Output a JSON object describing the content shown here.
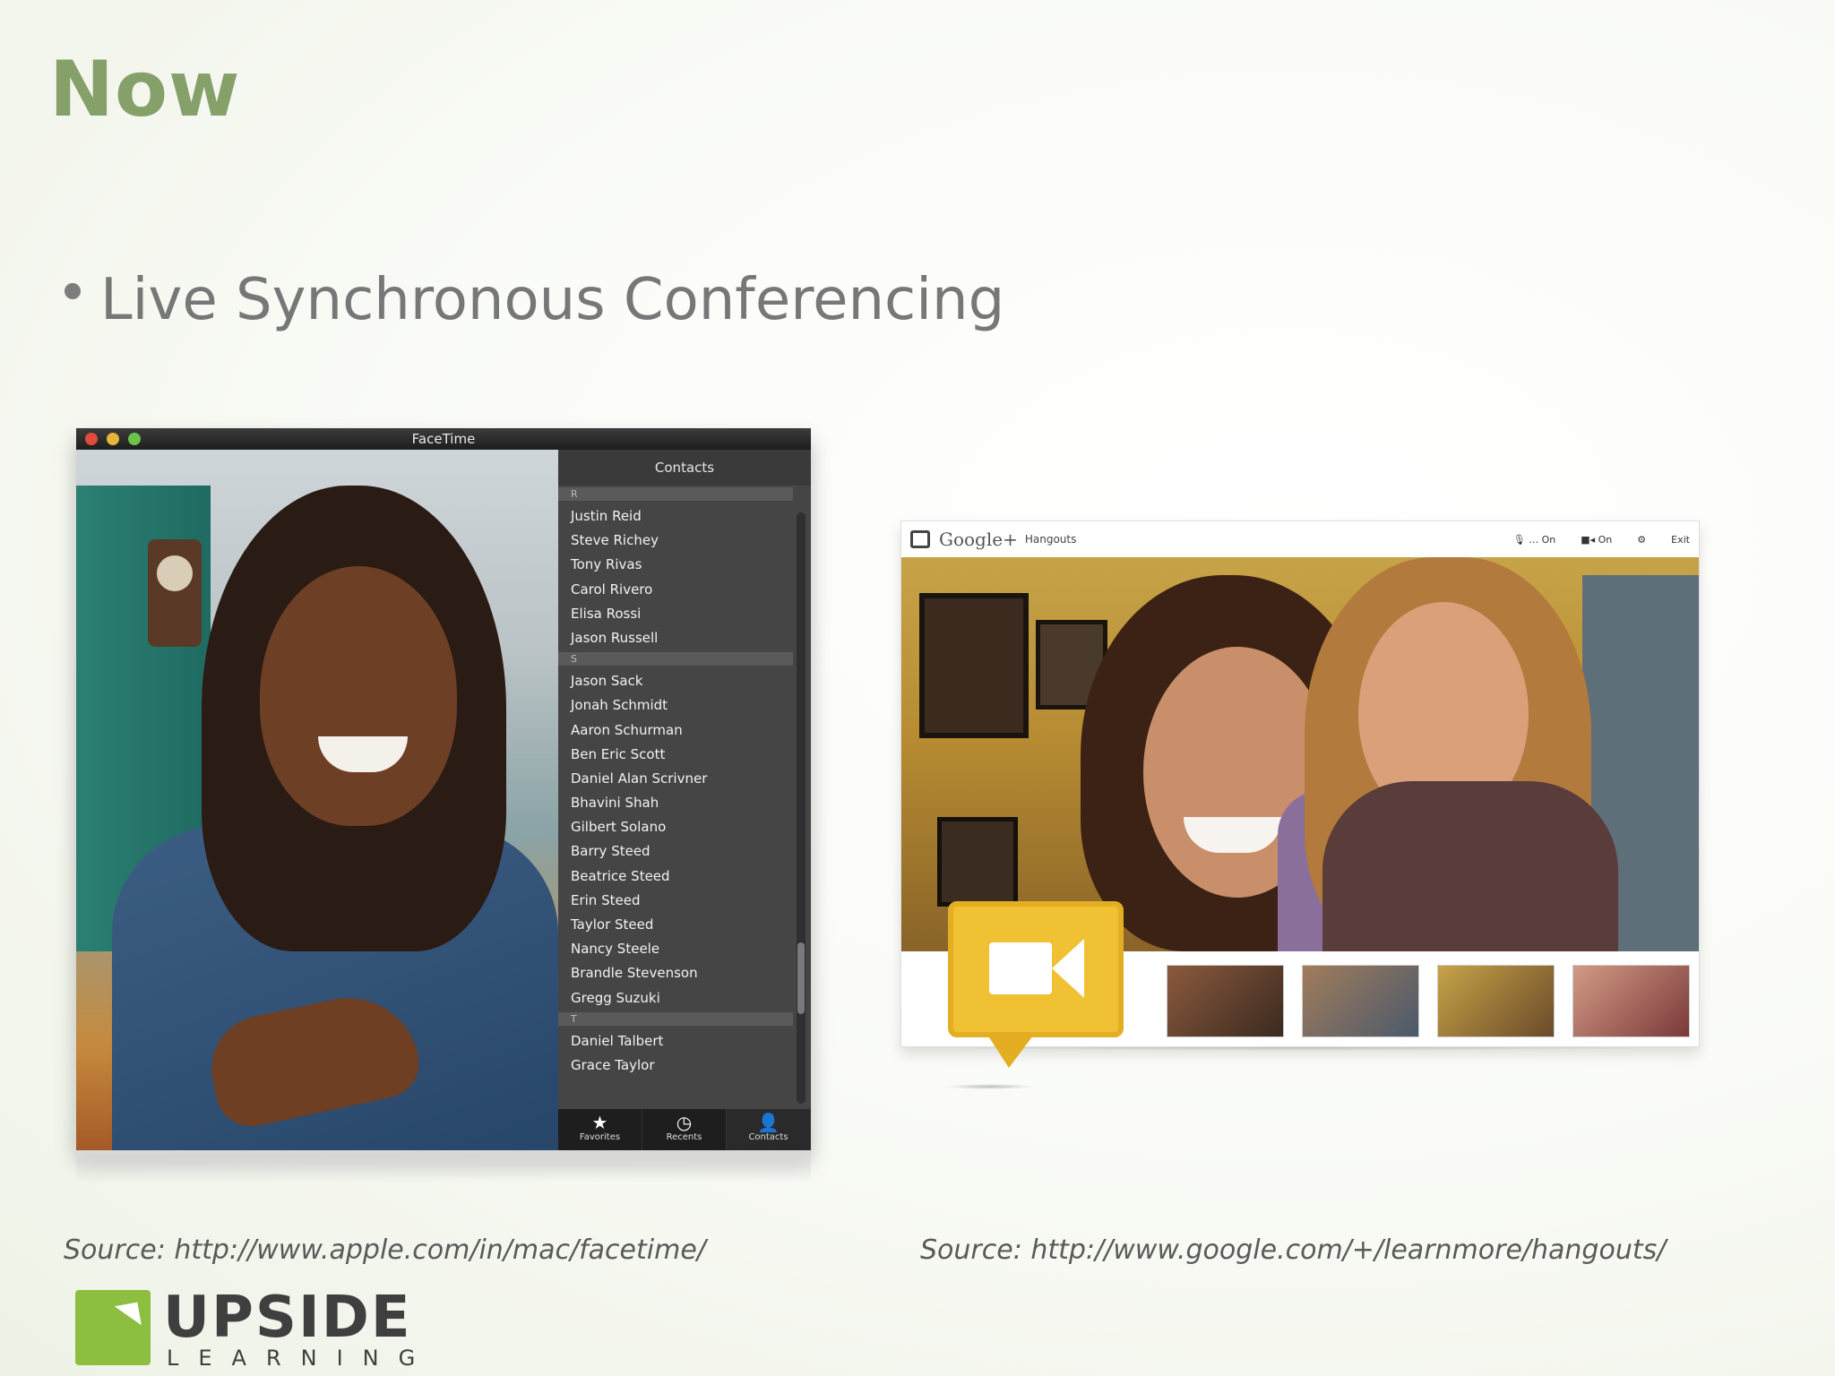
{
  "slide": {
    "title": "Now",
    "bullet": "Live Synchronous Conferencing"
  },
  "facetime": {
    "window_title": "FaceTime",
    "contacts_header": "Contacts",
    "sections": [
      {
        "letter": "R",
        "contacts": [
          "Justin Reid",
          "Steve Richey",
          "Tony Rivas",
          "Carol Rivero",
          "Elisa Rossi",
          "Jason Russell"
        ]
      },
      {
        "letter": "S",
        "contacts": [
          "Jason Sack",
          "Jonah Schmidt",
          "Aaron Schurman",
          "Ben Eric Scott",
          "Daniel Alan Scrivner",
          "Bhavini Shah",
          "Gilbert Solano",
          "Barry Steed",
          "Beatrice Steed",
          "Erin Steed",
          "Taylor Steed",
          "Nancy Steele",
          "Brandle Stevenson",
          "Gregg Suzuki"
        ]
      },
      {
        "letter": "T",
        "contacts": [
          "Daniel Talbert",
          "Grace Taylor"
        ]
      }
    ],
    "tabs": [
      {
        "label": "Favorites",
        "icon": "star-icon",
        "glyph": "★"
      },
      {
        "label": "Recents",
        "icon": "clock-icon",
        "glyph": "◷"
      },
      {
        "label": "Contacts",
        "icon": "person-icon",
        "glyph": "👤"
      }
    ],
    "active_tab": "Contacts"
  },
  "hangouts": {
    "brand": "Google+",
    "product": "Hangouts",
    "mic_label": "On",
    "camera_label": "On",
    "exit_label": "Exit"
  },
  "sources": {
    "left": "Source: http://www.apple.com/in/mac/facetime/",
    "right": "Source: http://www.google.com/+/learnmore/hangouts/"
  },
  "logo": {
    "main": "UPSIDE",
    "sub": "LEARNING"
  }
}
